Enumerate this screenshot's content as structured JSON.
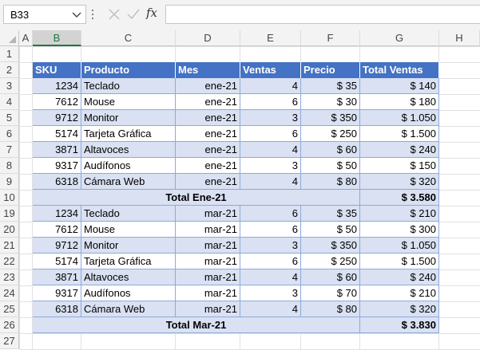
{
  "formula_bar": {
    "name_box": "B33",
    "fx_label": "fx",
    "formula": ""
  },
  "columns": [
    "A",
    "B",
    "C",
    "D",
    "E",
    "F",
    "G",
    "H"
  ],
  "rows": [
    "1",
    "2",
    "3",
    "4",
    "5",
    "6",
    "7",
    "8",
    "9",
    "10",
    "19",
    "20",
    "21",
    "22",
    "23",
    "24",
    "25",
    "26",
    "27"
  ],
  "table": {
    "headers": [
      "SKU",
      "Producto",
      "Mes",
      "Ventas",
      "Precio",
      "Total Ventas"
    ],
    "group1": [
      {
        "sku": "1234",
        "producto": "Teclado",
        "mes": "ene-21",
        "ventas": "4",
        "precio": "$ 35",
        "total": "$ 140"
      },
      {
        "sku": "7612",
        "producto": "Mouse",
        "mes": "ene-21",
        "ventas": "6",
        "precio": "$ 30",
        "total": "$ 180"
      },
      {
        "sku": "9712",
        "producto": "Monitor",
        "mes": "ene-21",
        "ventas": "3",
        "precio": "$ 350",
        "total": "$ 1.050"
      },
      {
        "sku": "5174",
        "producto": "Tarjeta Gráfica",
        "mes": "ene-21",
        "ventas": "6",
        "precio": "$ 250",
        "total": "$ 1.500"
      },
      {
        "sku": "3871",
        "producto": "Altavoces",
        "mes": "ene-21",
        "ventas": "4",
        "precio": "$ 60",
        "total": "$ 240"
      },
      {
        "sku": "9317",
        "producto": "Audífonos",
        "mes": "ene-21",
        "ventas": "3",
        "precio": "$ 50",
        "total": "$ 150"
      },
      {
        "sku": "6318",
        "producto": "Cámara Web",
        "mes": "ene-21",
        "ventas": "4",
        "precio": "$ 80",
        "total": "$ 320"
      }
    ],
    "subtotal1": {
      "label": "Total Ene-21",
      "total": "$ 3.580"
    },
    "group2": [
      {
        "sku": "1234",
        "producto": "Teclado",
        "mes": "mar-21",
        "ventas": "6",
        "precio": "$ 35",
        "total": "$ 210"
      },
      {
        "sku": "7612",
        "producto": "Mouse",
        "mes": "mar-21",
        "ventas": "6",
        "precio": "$ 50",
        "total": "$ 300"
      },
      {
        "sku": "9712",
        "producto": "Monitor",
        "mes": "mar-21",
        "ventas": "3",
        "precio": "$ 350",
        "total": "$ 1.050"
      },
      {
        "sku": "5174",
        "producto": "Tarjeta Gráfica",
        "mes": "mar-21",
        "ventas": "6",
        "precio": "$ 250",
        "total": "$ 1.500"
      },
      {
        "sku": "3871",
        "producto": "Altavoces",
        "mes": "mar-21",
        "ventas": "4",
        "precio": "$ 60",
        "total": "$ 240"
      },
      {
        "sku": "9317",
        "producto": "Audífonos",
        "mes": "mar-21",
        "ventas": "3",
        "precio": "$ 70",
        "total": "$ 210"
      },
      {
        "sku": "6318",
        "producto": "Cámara Web",
        "mes": "mar-21",
        "ventas": "4",
        "precio": "$ 80",
        "total": "$ 320"
      }
    ],
    "subtotal2": {
      "label": "Total Mar-21",
      "total": "$ 3.830"
    }
  },
  "colors": {
    "header_blue": "#4472c4",
    "band_blue": "#d9e1f2",
    "selected_col_green": "#217346"
  }
}
